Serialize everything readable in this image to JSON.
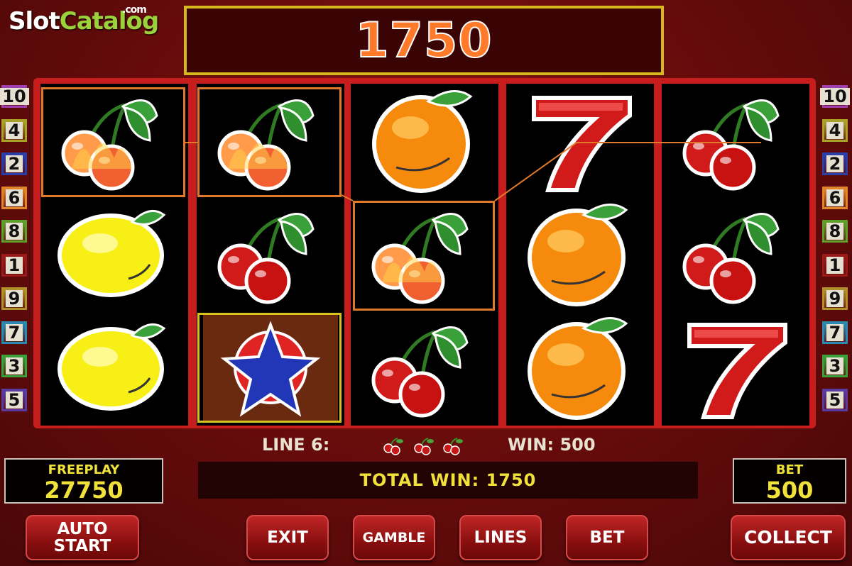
{
  "logo": {
    "part1": "Slot",
    "part2": "Catalog",
    "suffix": ".com"
  },
  "top_win": "1750",
  "left_lines": [
    {
      "n": "10",
      "color": "#a23fb0"
    },
    {
      "n": "4",
      "color": "#a8a22a"
    },
    {
      "n": "2",
      "color": "#2a3ea8"
    },
    {
      "n": "6",
      "color": "#e0852a"
    },
    {
      "n": "8",
      "color": "#5fa02a"
    },
    {
      "n": "1",
      "color": "#9a1a1a"
    },
    {
      "n": "9",
      "color": "#b0902a"
    },
    {
      "n": "7",
      "color": "#2a8ab0"
    },
    {
      "n": "3",
      "color": "#3aa03a"
    },
    {
      "n": "5",
      "color": "#5a3aa0"
    }
  ],
  "right_lines": [
    {
      "n": "10",
      "color": "#a23fb0"
    },
    {
      "n": "4",
      "color": "#a8a22a"
    },
    {
      "n": "2",
      "color": "#2a3ea8"
    },
    {
      "n": "6",
      "color": "#e0852a"
    },
    {
      "n": "8",
      "color": "#5fa02a"
    },
    {
      "n": "1",
      "color": "#9a1a1a"
    },
    {
      "n": "9",
      "color": "#b0902a"
    },
    {
      "n": "7",
      "color": "#2a8ab0"
    },
    {
      "n": "3",
      "color": "#3aa03a"
    },
    {
      "n": "5",
      "color": "#5a3aa0"
    }
  ],
  "reels": [
    [
      "cherry-burning",
      "lemon",
      "lemon"
    ],
    [
      "cherry-burning",
      "cherry",
      "star"
    ],
    [
      "orange",
      "cherry-burning",
      "cherry"
    ],
    [
      "seven",
      "orange",
      "orange"
    ],
    [
      "cherry",
      "cherry",
      "seven"
    ]
  ],
  "line_info": {
    "line_label": "LINE 6:",
    "win_label": "WIN: 500"
  },
  "total_win": "TOTAL WIN: 1750",
  "freeplay": {
    "label": "FREEPLAY",
    "value": "27750"
  },
  "bet_box": {
    "label": "BET",
    "value": "500"
  },
  "buttons": {
    "auto_start_1": "AUTO",
    "auto_start_2": "START",
    "exit": "EXIT",
    "gamble": "GAMBLE",
    "lines": "LINES",
    "bet": "BET",
    "collect": "COLLECT"
  }
}
